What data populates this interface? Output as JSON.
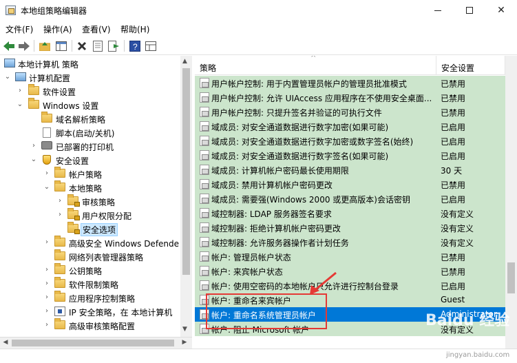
{
  "window": {
    "title": "本地组策略编辑器"
  },
  "menu": [
    "文件(F)",
    "操作(A)",
    "查看(V)",
    "帮助(H)"
  ],
  "tree": [
    {
      "label": "本地计算机 策略",
      "icon": "computer-icon",
      "expanded": ""
    },
    {
      "label": "计算机配置",
      "icon": "computer-icon",
      "expanded": "open"
    },
    {
      "label": "软件设置",
      "icon": "folder-icon",
      "expanded": "closed"
    },
    {
      "label": "Windows 设置",
      "icon": "folder-icon",
      "expanded": "open"
    },
    {
      "label": "域名解析策略",
      "icon": "folder-icon",
      "expanded": ""
    },
    {
      "label": "脚本(启动/关机)",
      "icon": "script-icon",
      "expanded": ""
    },
    {
      "label": "已部署的打印机",
      "icon": "printer-icon",
      "expanded": "closed"
    },
    {
      "label": "安全设置",
      "icon": "shield-icon",
      "expanded": "open"
    },
    {
      "label": "帐户策略",
      "icon": "folder-icon",
      "expanded": "closed"
    },
    {
      "label": "本地策略",
      "icon": "folder-icon",
      "expanded": "open"
    },
    {
      "label": "审核策略",
      "icon": "locked-folder-icon",
      "expanded": "closed"
    },
    {
      "label": "用户权限分配",
      "icon": "locked-folder-icon",
      "expanded": "closed"
    },
    {
      "label": "安全选项",
      "icon": "locked-folder-icon",
      "expanded": "",
      "selected": true
    },
    {
      "label": "高级安全 Windows Defende",
      "icon": "folder-icon",
      "expanded": "closed"
    },
    {
      "label": "网络列表管理器策略",
      "icon": "folder-icon",
      "expanded": ""
    },
    {
      "label": "公钥策略",
      "icon": "folder-icon",
      "expanded": "closed"
    },
    {
      "label": "软件限制策略",
      "icon": "folder-icon",
      "expanded": "closed"
    },
    {
      "label": "应用程序控制策略",
      "icon": "folder-icon",
      "expanded": "closed"
    },
    {
      "label": "IP 安全策略，在 本地计算机",
      "icon": "ip-security-icon",
      "expanded": "closed"
    },
    {
      "label": "高级审核策略配置",
      "icon": "folder-icon",
      "expanded": "closed"
    }
  ],
  "list": {
    "col_policy": "策略",
    "col_setting": "安全设置",
    "sort_caret": "^",
    "rows": [
      {
        "policy": "用户帐户控制: 用于内置管理员帐户的管理员批准模式",
        "setting": "已禁用"
      },
      {
        "policy": "用户帐户控制: 允许 UIAccess 应用程序在不使用安全桌面...",
        "setting": "已禁用"
      },
      {
        "policy": "用户帐户控制: 只提升签名并验证的可执行文件",
        "setting": "已禁用"
      },
      {
        "policy": "域成员: 对安全通道数据进行数字加密(如果可能)",
        "setting": "已启用"
      },
      {
        "policy": "域成员: 对安全通道数据进行数字加密或数字签名(始终)",
        "setting": "已启用"
      },
      {
        "policy": "域成员: 对安全通道数据进行数字签名(如果可能)",
        "setting": "已启用"
      },
      {
        "policy": "域成员: 计算机帐户密码最长使用期限",
        "setting": "30 天"
      },
      {
        "policy": "域成员: 禁用计算机帐户密码更改",
        "setting": "已禁用"
      },
      {
        "policy": "域成员: 需要强(Windows 2000 或更高版本)会话密钥",
        "setting": "已启用"
      },
      {
        "policy": "域控制器: LDAP 服务器签名要求",
        "setting": "没有定义"
      },
      {
        "policy": "域控制器: 拒绝计算机帐户密码更改",
        "setting": "没有定义"
      },
      {
        "policy": "域控制器: 允许服务器操作者计划任务",
        "setting": "没有定义"
      },
      {
        "policy": "帐户: 管理员帐户状态",
        "setting": "已禁用"
      },
      {
        "policy": "帐户: 来宾帐户状态",
        "setting": "已禁用"
      },
      {
        "policy": "帐户: 使用空密码的本地帐户只允许进行控制台登录",
        "setting": "已启用"
      },
      {
        "policy": "帐户: 重命名来宾帐户",
        "setting": "Guest"
      },
      {
        "policy": "帐户: 重命名系统管理员帐户",
        "setting": "Administrator",
        "selected": true
      },
      {
        "policy": "帐户: 阻止 Microsoft 帐户",
        "setting": "没有定义"
      }
    ]
  },
  "watermark": {
    "brand": "Baidu 经验",
    "url": "jingyan.baidu.com"
  },
  "colors": {
    "row_bg": "#cce5cc",
    "selection": "#0078d7",
    "callout": "#e53935"
  }
}
